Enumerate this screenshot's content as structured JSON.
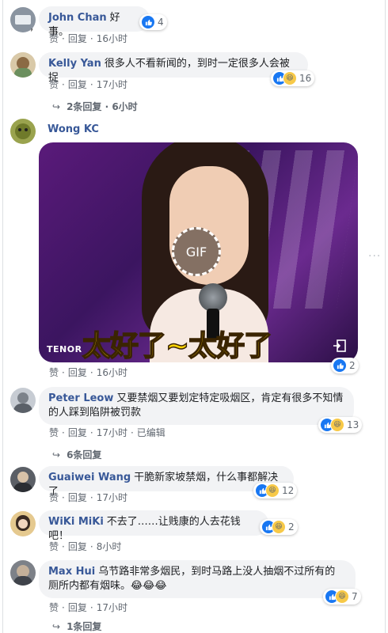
{
  "comments": [
    {
      "name": "John Chan",
      "text": "好事。",
      "actions": {
        "like": "赞",
        "reply": "回复",
        "time": "16小时"
      },
      "reactions": {
        "types": [
          "like"
        ],
        "count": "4"
      }
    },
    {
      "name": "Kelly Yan",
      "text": "很多人不看新闻的，到时一定很多人会被捉",
      "actions": {
        "like": "赞",
        "reply": "回复",
        "time": "17小时"
      },
      "reactions": {
        "types": [
          "like",
          "haha"
        ],
        "count": "16"
      },
      "replies": "2条回复 · 6小时"
    },
    {
      "name": "Wong KC",
      "gif": {
        "source": "TENOR",
        "badge": "GIF",
        "caption": "太好了~太好了"
      },
      "actions": {
        "like": "赞",
        "reply": "回复",
        "time": "16小时"
      },
      "reactions": {
        "types": [
          "like"
        ],
        "count": "2"
      }
    },
    {
      "name": "Peter Leow",
      "text_line1": "又要禁烟又要划定特定吸烟区，肯定有很多不知情",
      "text_line2": "的人踩到陷阱被罚款",
      "actions": {
        "like": "赞",
        "reply": "回复",
        "time": "17小时",
        "edited": "已编辑"
      },
      "reactions": {
        "types": [
          "like",
          "haha"
        ],
        "count": "13"
      },
      "replies": "6条回复"
    },
    {
      "name": "Guaiwei Wang",
      "text": "干脆新家坡禁烟，什么事都解决了",
      "actions": {
        "like": "赞",
        "reply": "回复",
        "time": "17小时"
      },
      "reactions": {
        "types": [
          "like",
          "haha"
        ],
        "count": "12"
      }
    },
    {
      "name": "WiKi MiKi",
      "text": "不去了……让贱康的人去花钱吧！",
      "actions": {
        "like": "赞",
        "reply": "回复",
        "time": "8小时"
      },
      "reactions": {
        "types": [
          "like",
          "haha"
        ],
        "count": "2"
      }
    },
    {
      "name": "Max Hui",
      "text_line1": "乌节路非常多烟民，到时马路上没人抽烟不过所有的",
      "text_line2": "厕所内都有烟味。😂😂😂",
      "actions": {
        "like": "赞",
        "reply": "回复",
        "time": "17小时"
      },
      "reactions": {
        "types": [
          "like",
          "haha"
        ],
        "count": "7"
      },
      "replies": "1条回复"
    }
  ],
  "more_label": "···",
  "colors": {
    "name": "#385898",
    "bubble": "#f2f3f5",
    "like": "#1877f2",
    "haha": "#f7c948",
    "meta": "#606770"
  }
}
